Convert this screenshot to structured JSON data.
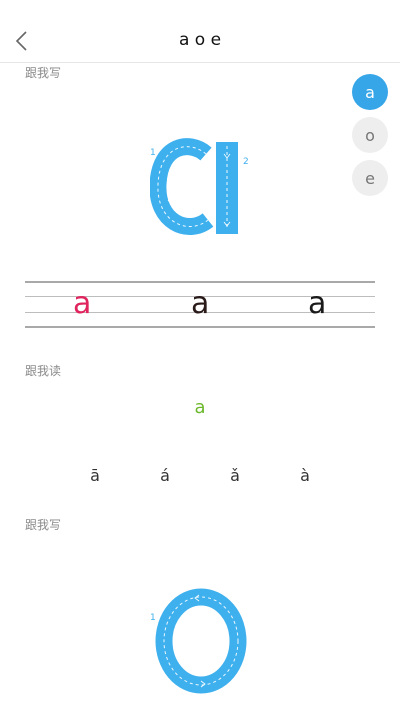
{
  "header": {
    "title": "a o e"
  },
  "tabs": [
    {
      "label": "a",
      "active": true
    },
    {
      "label": "o",
      "active": false
    },
    {
      "label": "e",
      "active": false
    }
  ],
  "section_write_1": {
    "label": "跟我写",
    "letter": "a",
    "stroke_numbers": [
      "1",
      "2"
    ]
  },
  "practice": {
    "letters": [
      "a",
      "a",
      "a"
    ],
    "colors": [
      "#e0245e",
      "#2a1a1a",
      "#1a1a1a"
    ]
  },
  "section_read": {
    "label": "跟我读",
    "letter": "a",
    "tones": [
      "ā",
      "á",
      "ǎ",
      "à"
    ]
  },
  "section_write_2": {
    "label": "跟我写",
    "letter": "o",
    "stroke_numbers": [
      "1"
    ]
  },
  "colors": {
    "accent": "#37a6e8",
    "letter_fill": "#3fb0ee",
    "read_green": "#6bb82a",
    "practice_red": "#e0245e"
  }
}
